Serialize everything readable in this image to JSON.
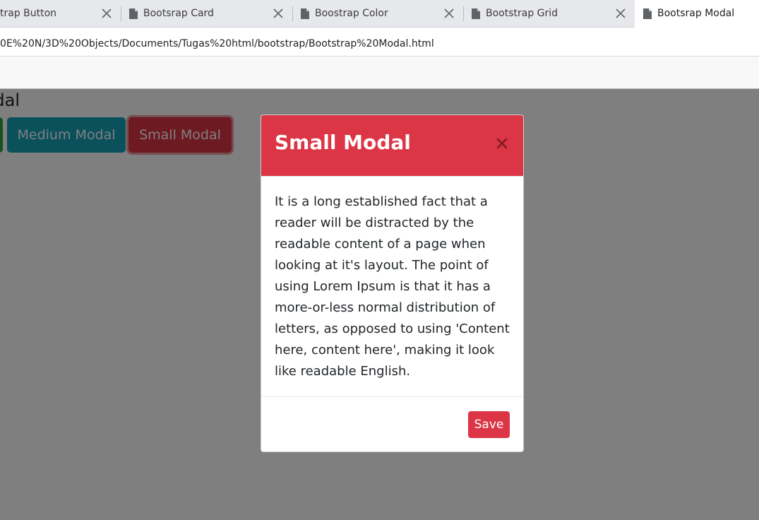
{
  "browser": {
    "tabs": [
      {
        "label": "trap Button"
      },
      {
        "label": "Bootsrap Card"
      },
      {
        "label": "Boostrap Color"
      },
      {
        "label": "Bootstrap Grid"
      },
      {
        "label": "Bootsrap Modal",
        "active": true
      }
    ],
    "url": "0E%20N/3D%20Objects/Documents/Tugas%20html/bootstrap/Bootstrap%20Modal.html"
  },
  "page": {
    "heading": "Modal",
    "buttons": [
      {
        "label": ""
      },
      {
        "label": "Medium Modal"
      },
      {
        "label": "Small Modal"
      }
    ]
  },
  "modal": {
    "title": "Small Modal",
    "body": "It is a long established fact that a reader will be distracted by the readable content of a page when looking at it's layout. The point of using Lorem Ipsum is that it has a more-or-less normal distribution of letters, as opposed to using 'Content here, content here', making it look like readable English.",
    "save_label": "Save"
  },
  "colors": {
    "danger": "#dc3545",
    "info": "#17a2b8",
    "success": "#28a745",
    "backdrop": "rgba(0,0,0,0.5)"
  },
  "icons": {
    "tab_icon": "document-icon",
    "tab_close": "close-icon",
    "modal_close": "close-icon"
  }
}
